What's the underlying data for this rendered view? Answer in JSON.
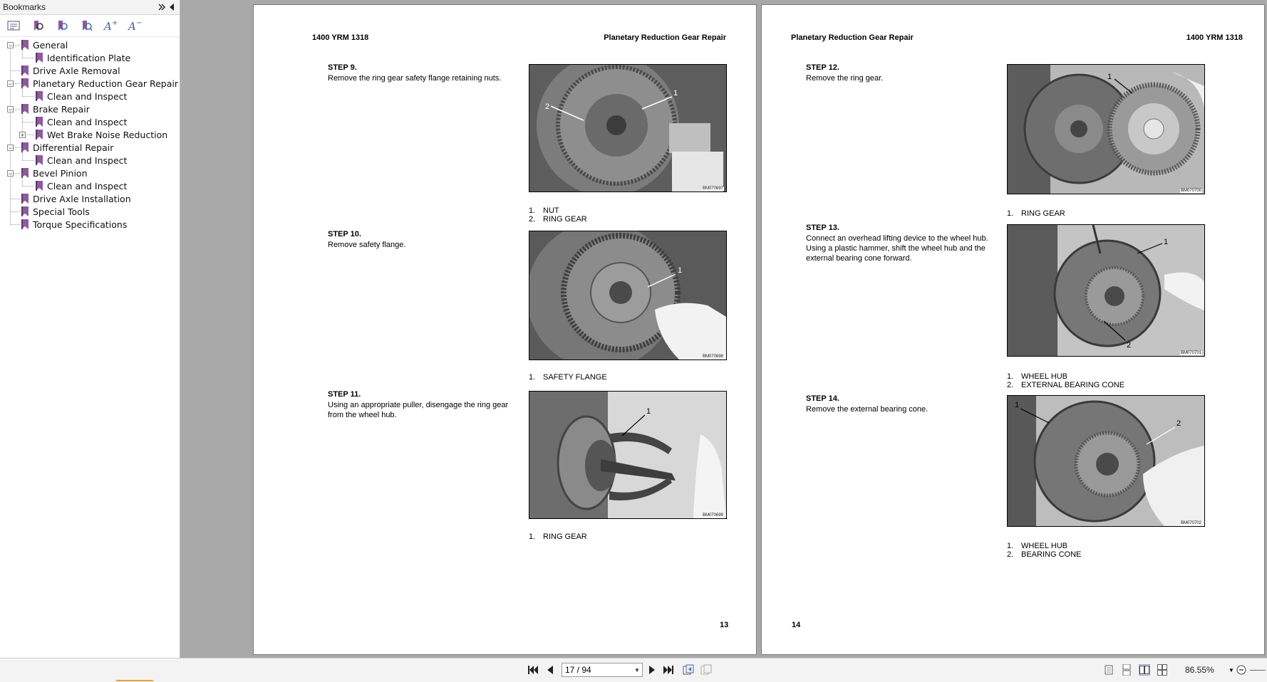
{
  "sidebar": {
    "title": "Bookmarks",
    "tools": [
      "options-icon",
      "expand-bookmark-icon",
      "find-bookmark-icon",
      "bookmark-search-icon",
      "increase-font-icon",
      "decrease-font-icon"
    ],
    "items": [
      {
        "label": "General",
        "level": 0,
        "expander": "−"
      },
      {
        "label": "Identification Plate",
        "level": 1,
        "expander": ""
      },
      {
        "label": "Drive Axle Removal",
        "level": 0,
        "expander": ""
      },
      {
        "label": "Planetary Reduction Gear Repair",
        "level": 0,
        "expander": "−"
      },
      {
        "label": "Clean and Inspect",
        "level": 1,
        "expander": ""
      },
      {
        "label": "Brake Repair",
        "level": 0,
        "expander": "−"
      },
      {
        "label": "Clean and Inspect",
        "level": 1,
        "expander": ""
      },
      {
        "label": "Wet Brake Noise Reduction",
        "level": 1,
        "expander": "+"
      },
      {
        "label": "Differential Repair",
        "level": 0,
        "expander": "−"
      },
      {
        "label": "Clean and Inspect",
        "level": 1,
        "expander": ""
      },
      {
        "label": "Bevel Pinion",
        "level": 0,
        "expander": "−"
      },
      {
        "label": "Clean and Inspect",
        "level": 1,
        "expander": ""
      },
      {
        "label": "Drive Axle Installation",
        "level": 0,
        "expander": ""
      },
      {
        "label": "Special Tools",
        "level": 0,
        "expander": ""
      },
      {
        "label": "Torque Specifications",
        "level": 0,
        "expander": ""
      }
    ]
  },
  "pages": {
    "left": {
      "header_left": "1400 YRM 1318",
      "header_right": "Planetary Reduction Gear Repair",
      "page_number": "13",
      "steps": [
        {
          "title": "STEP 9.",
          "text": "Remove the ring gear safety flange retaining nuts.",
          "figure_code": "BM070697",
          "figure_labels": [
            "1",
            "2"
          ],
          "callouts": [
            {
              "n": "1.",
              "t": "NUT"
            },
            {
              "n": "2.",
              "t": "RING GEAR"
            }
          ]
        },
        {
          "title": "STEP 10.",
          "text": "Remove safety flange.",
          "figure_code": "BM070698",
          "figure_labels": [
            "1"
          ],
          "callouts": [
            {
              "n": "1.",
              "t": "SAFETY FLANGE"
            }
          ]
        },
        {
          "title": "STEP 11.",
          "text": "Using an appropriate puller, disengage the ring gear from the wheel hub.",
          "figure_code": "BM070699",
          "figure_labels": [
            "1"
          ],
          "callouts": [
            {
              "n": "1.",
              "t": "RING GEAR"
            }
          ]
        }
      ]
    },
    "right": {
      "header_left": "Planetary Reduction Gear Repair",
      "header_right": "1400 YRM 1318",
      "page_number": "14",
      "steps": [
        {
          "title": "STEP 12.",
          "text": "Remove the ring gear.",
          "figure_code": "BM070700",
          "figure_labels": [
            "1"
          ],
          "callouts": [
            {
              "n": "1.",
              "t": "RING GEAR"
            }
          ]
        },
        {
          "title": "STEP 13.",
          "text": "Connect an overhead lifting device to the wheel hub. Using a plastic hammer, shift the wheel hub and the external bearing cone forward.",
          "figure_code": "BM070701",
          "figure_labels": [
            "1",
            "2"
          ],
          "callouts": [
            {
              "n": "1.",
              "t": "WHEEL HUB"
            },
            {
              "n": "2.",
              "t": "EXTERNAL BEARING CONE"
            }
          ]
        },
        {
          "title": "STEP 14.",
          "text": "Remove the external bearing cone.",
          "figure_code": "BM070702",
          "figure_labels": [
            "1",
            "2"
          ],
          "callouts": [
            {
              "n": "1.",
              "t": "WHEEL HUB"
            },
            {
              "n": "2.",
              "t": "BEARING CONE"
            }
          ]
        }
      ]
    }
  },
  "toolbar": {
    "page_field": "17 / 94",
    "zoom": "86.55%",
    "buttons": [
      "first-page-icon",
      "previous-page-icon",
      "next-page-icon",
      "last-page-icon",
      "previous-view-icon",
      "next-view-icon",
      "single-page-icon",
      "continuous-icon",
      "facing-icon",
      "continuous-facing-icon",
      "zoom-dropdown-icon",
      "zoom-out-icon"
    ]
  },
  "colors": {
    "doc_background": "#a9a9a9",
    "bookmark_icon": "#8e5aa0",
    "page": "#ffffff",
    "accent_orange": "#f0a030"
  }
}
